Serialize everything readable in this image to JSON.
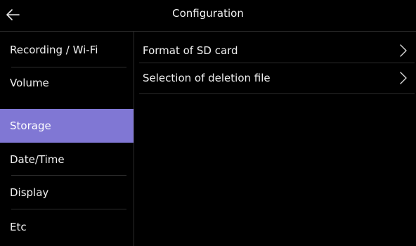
{
  "header": {
    "title": "Configuration",
    "back_icon": "arrow-left-icon"
  },
  "sidebar": {
    "items": [
      {
        "label": "Recording / Wi-Fi",
        "active": false
      },
      {
        "label": "Volume",
        "active": false
      },
      {
        "label": "Storage",
        "active": true
      },
      {
        "label": "Date/Time",
        "active": false
      },
      {
        "label": "Display",
        "active": false
      },
      {
        "label": "Etc",
        "active": false
      }
    ],
    "active_color": "#8077d4"
  },
  "main": {
    "items": [
      {
        "label": "Format of SD card",
        "icon": "chevron-right-icon"
      },
      {
        "label": "Selection of deletion file",
        "icon": "chevron-right-icon"
      }
    ]
  }
}
